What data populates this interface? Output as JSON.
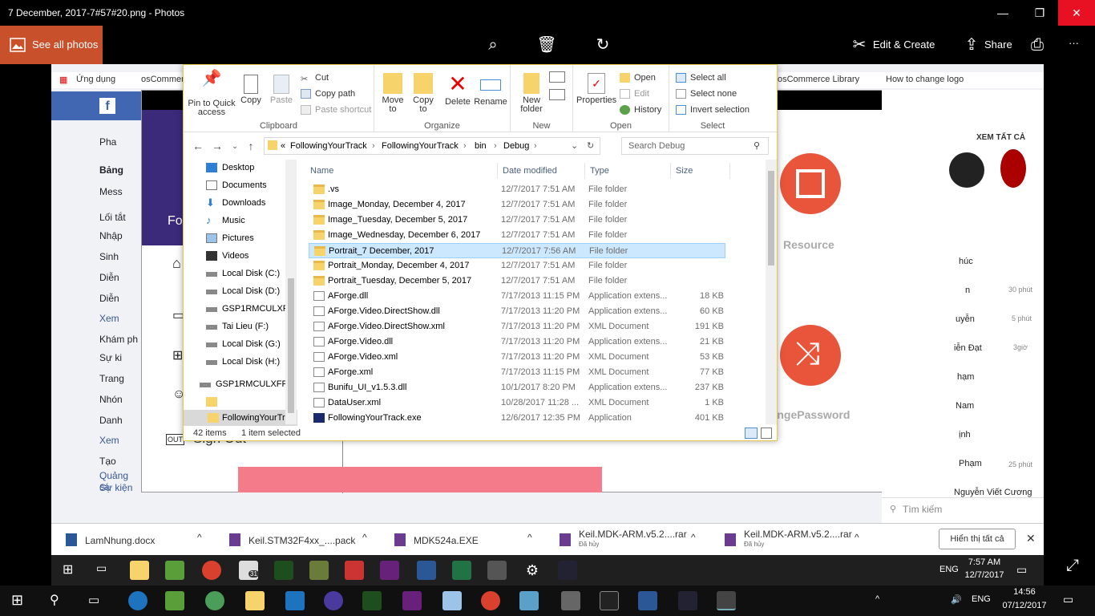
{
  "viewer": {
    "title": "7 December, 2017-7#57#20.png - Photos",
    "see_all": "See all photos",
    "edit_create": "Edit & Create",
    "share": "Share",
    "more": "···"
  },
  "background": {
    "bookmarks": [
      "Ứng dụng",
      "osCommer",
      "osCommerce Library",
      "How to change logo"
    ],
    "fb_left": [
      "Pha",
      "Bảng",
      "Mess",
      "Lối tắt",
      "Nhập",
      "Sinh",
      "Diễn",
      "Diễn",
      "Xem",
      "Khám ph",
      "Sự ki",
      "Trang",
      "Nhón",
      "Danh",
      "Xem",
      "Tạo",
      "Quảng cá",
      "Sự kiện"
    ],
    "app_labels": {
      "fo": "Fo",
      "sign_out": "Sign Out",
      "resource": "Resource",
      "change_password": "hangePassword"
    },
    "chat": {
      "header": "XEM TẤT CẢ",
      "names": [
        "húc",
        "n",
        "uyễn",
        "iễn Đạt",
        "hạm",
        "Nam",
        "ịnh",
        "Phạm",
        "Nguyễn Viết Cương"
      ],
      "times": [
        "30 phút",
        "5 phút",
        "3giờ",
        "25 phút"
      ],
      "search": "Tìm kiếm"
    }
  },
  "explorer": {
    "ribbon": {
      "clipboard": {
        "label": "Clipboard",
        "pin": "Pin to Quick access",
        "copy": "Copy",
        "paste": "Paste",
        "cut": "Cut",
        "copy_path": "Copy path",
        "paste_shortcut": "Paste shortcut"
      },
      "organize": {
        "label": "Organize",
        "move_to": "Move to",
        "copy_to": "Copy to",
        "delete": "Delete",
        "rename": "Rename"
      },
      "new": {
        "label": "New",
        "new_folder": "New folder"
      },
      "open": {
        "label": "Open",
        "properties": "Properties",
        "open": "Open",
        "edit": "Edit",
        "history": "History"
      },
      "select": {
        "label": "Select",
        "select_all": "Select all",
        "select_none": "Select none",
        "invert": "Invert selection"
      }
    },
    "address": {
      "prefix": "«",
      "crumbs": [
        "FollowingYourTrack",
        "FollowingYourTrack",
        "bin",
        "Debug"
      ]
    },
    "search_placeholder": "Search Debug",
    "nav": [
      "Desktop",
      "Documents",
      "Downloads",
      "Music",
      "Pictures",
      "Videos",
      "Local Disk (C:)",
      "Local Disk (D:)",
      "GSP1RMCULXFR",
      "Tai Lieu (F:)",
      "Local Disk (G:)",
      "Local Disk (H:)",
      "GSP1RMCULXFRE",
      "",
      "FollowingYourTr"
    ],
    "columns": {
      "name": "Name",
      "date": "Date modified",
      "type": "Type",
      "size": "Size"
    },
    "files": [
      {
        "name": ".vs",
        "date": "12/7/2017 7:51 AM",
        "type": "File folder",
        "size": "",
        "kind": "folder"
      },
      {
        "name": "Image_Monday, December 4, 2017",
        "date": "12/7/2017 7:51 AM",
        "type": "File folder",
        "size": "",
        "kind": "folder"
      },
      {
        "name": "Image_Tuesday, December 5, 2017",
        "date": "12/7/2017 7:51 AM",
        "type": "File folder",
        "size": "",
        "kind": "folder"
      },
      {
        "name": "Image_Wednesday, December 6, 2017",
        "date": "12/7/2017 7:51 AM",
        "type": "File folder",
        "size": "",
        "kind": "folder"
      },
      {
        "name": "Portrait_7 December, 2017",
        "date": "12/7/2017 7:56 AM",
        "type": "File folder",
        "size": "",
        "kind": "folder"
      },
      {
        "name": "Portrait_Monday, December 4, 2017",
        "date": "12/7/2017 7:51 AM",
        "type": "File folder",
        "size": "",
        "kind": "folder"
      },
      {
        "name": "Portrait_Tuesday, December 5, 2017",
        "date": "12/7/2017 7:51 AM",
        "type": "File folder",
        "size": "",
        "kind": "folder"
      },
      {
        "name": "AForge.dll",
        "date": "7/17/2013 11:15 PM",
        "type": "Application extens...",
        "size": "18 KB",
        "kind": "file"
      },
      {
        "name": "AForge.Video.DirectShow.dll",
        "date": "7/17/2013 11:20 PM",
        "type": "Application extens...",
        "size": "60 KB",
        "kind": "file"
      },
      {
        "name": "AForge.Video.DirectShow.xml",
        "date": "7/17/2013 11:20 PM",
        "type": "XML Document",
        "size": "191 KB",
        "kind": "file"
      },
      {
        "name": "AForge.Video.dll",
        "date": "7/17/2013 11:20 PM",
        "type": "Application extens...",
        "size": "21 KB",
        "kind": "file"
      },
      {
        "name": "AForge.Video.xml",
        "date": "7/17/2013 11:20 PM",
        "type": "XML Document",
        "size": "53 KB",
        "kind": "file"
      },
      {
        "name": "AForge.xml",
        "date": "7/17/2013 11:15 PM",
        "type": "XML Document",
        "size": "77 KB",
        "kind": "file"
      },
      {
        "name": "Bunifu_UI_v1.5.3.dll",
        "date": "10/1/2017 8:20 PM",
        "type": "Application extens...",
        "size": "237 KB",
        "kind": "file"
      },
      {
        "name": "DataUser.xml",
        "date": "10/28/2017 11:28 ...",
        "type": "XML Document",
        "size": "1 KB",
        "kind": "file"
      },
      {
        "name": "FollowingYourTrack.exe",
        "date": "12/6/2017 12:35 PM",
        "type": "Application",
        "size": "401 KB",
        "kind": "exe"
      }
    ],
    "selected_index": 4,
    "status": {
      "count": "42 items",
      "selected": "1 item selected"
    }
  },
  "downloads": {
    "items": [
      {
        "name": "LamNhung.docx",
        "status": ""
      },
      {
        "name": "Keil.STM32F4xx_....pack",
        "status": ""
      },
      {
        "name": "MDK524a.EXE",
        "status": ""
      },
      {
        "name": "Keil.MDK-ARM.v5.2....rar",
        "status": "Đã hủy"
      },
      {
        "name": "Keil.MDK-ARM.v5.2....rar",
        "status": "Đã hủy"
      }
    ],
    "show_all": "Hiển thị tất cả"
  },
  "inner_taskbar": {
    "lang": "ENG",
    "time": "7:57 AM",
    "date": "12/7/2017",
    "mail_badge": "31"
  },
  "outer_taskbar": {
    "lang": "ENG",
    "time": "14:56",
    "date": "07/12/2017"
  },
  "colors": {
    "accent": "#c8502a",
    "fb_blue": "#4267b2",
    "selection": "#cce8ff",
    "folder": "#f7d46b"
  }
}
